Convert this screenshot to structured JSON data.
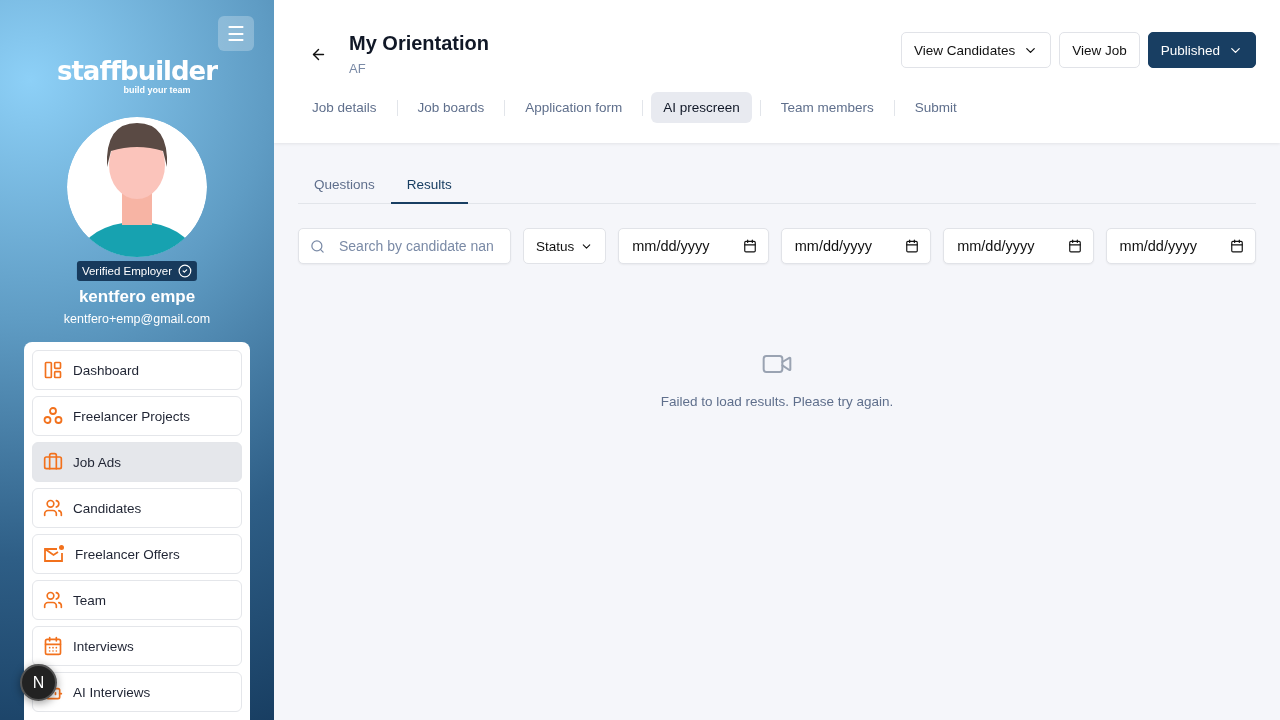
{
  "sidebar": {
    "menu_button": "☰",
    "logo": {
      "name": "staffbuilder",
      "tagline": "build your team"
    },
    "profile": {
      "badge": "Verified Employer",
      "name": "kentfero empe",
      "email": "kentfero+emp@gmail.com"
    },
    "items": [
      {
        "label": "Dashboard",
        "selected": false
      },
      {
        "label": "Freelancer Projects",
        "selected": false
      },
      {
        "label": "Job Ads",
        "selected": true
      },
      {
        "label": "Candidates",
        "selected": false
      },
      {
        "label": "Freelancer Offers",
        "selected": false
      },
      {
        "label": "Team",
        "selected": false
      },
      {
        "label": "Interviews",
        "selected": false
      },
      {
        "label": "AI Interviews",
        "selected": false
      }
    ]
  },
  "dev_badge": "N",
  "header": {
    "title": "My Orientation",
    "subtitle": "AF",
    "actions": [
      {
        "label": "View Candidates",
        "kind": "dropdown"
      },
      {
        "label": "View Job",
        "kind": "plain"
      },
      {
        "label": "Published",
        "kind": "primary"
      }
    ],
    "tabs": [
      {
        "label": "Job details",
        "selected": false
      },
      {
        "label": "Job boards",
        "selected": false
      },
      {
        "label": "Application form",
        "selected": false
      },
      {
        "label": "AI prescreen",
        "selected": true
      },
      {
        "label": "Team members",
        "selected": false
      },
      {
        "label": "Submit",
        "selected": false
      }
    ]
  },
  "subtabs": [
    {
      "label": "Questions",
      "selected": false
    },
    {
      "label": "Results",
      "selected": true
    }
  ],
  "filters": {
    "search": {
      "placeholder": "Search by candidate nan"
    },
    "status": "Status",
    "dates": [
      {
        "placeholder": "mm/dd/yyyy"
      },
      {
        "placeholder": "mm/dd/yyyy"
      },
      {
        "placeholder": "mm/dd/yyyy"
      },
      {
        "placeholder": "mm/dd/yyyy"
      }
    ]
  },
  "empty_state": {
    "message": "Failed to load results. Please try again."
  }
}
